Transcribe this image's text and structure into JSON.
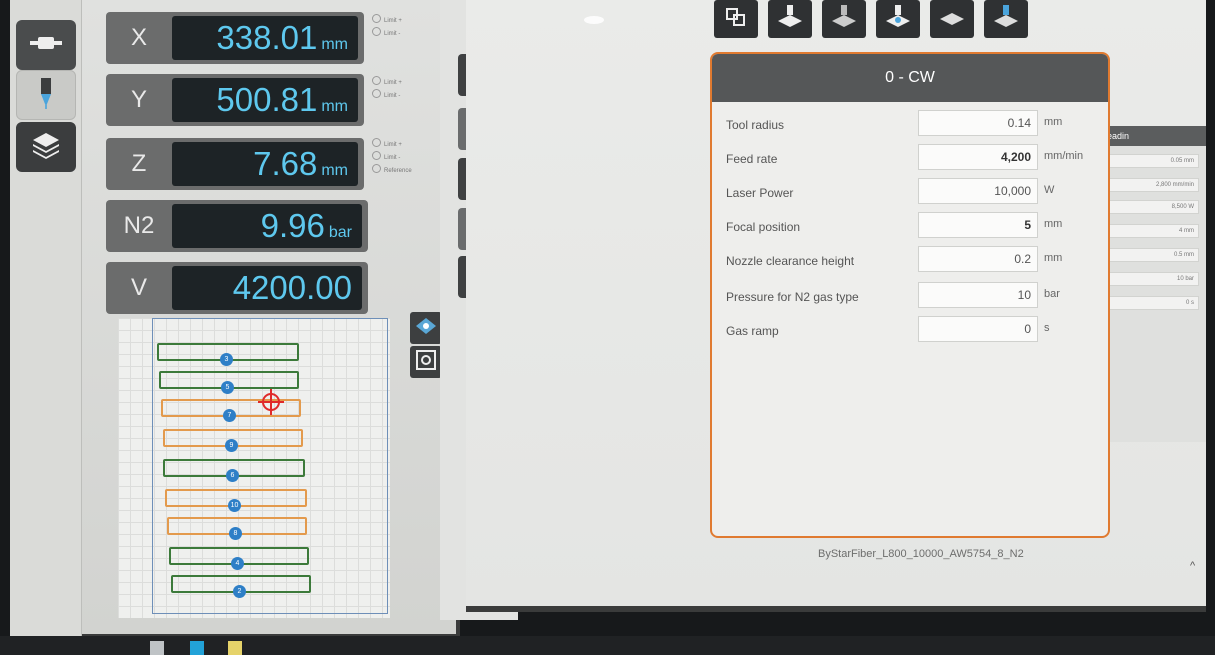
{
  "left_tabs": [
    {
      "name": "machine-tab",
      "icon": "machine-head-icon"
    },
    {
      "name": "laser-tab",
      "icon": "laser-nozzle-icon"
    },
    {
      "name": "layers-tab",
      "icon": "layers-icon"
    }
  ],
  "axes": [
    {
      "id": "x",
      "label": "X",
      "value": "338.01",
      "unit": "mm",
      "limits": [
        "Limit +",
        "Limit -"
      ]
    },
    {
      "id": "y",
      "label": "Y",
      "value": "500.81",
      "unit": "mm",
      "limits": [
        "Limit +",
        "Limit -"
      ]
    },
    {
      "id": "z",
      "label": "Z",
      "value": "7.68",
      "unit": "mm",
      "limits": [
        "Limit +",
        "Limit -",
        "Reference"
      ]
    },
    {
      "id": "n2",
      "label": "N2",
      "value": "9.96",
      "unit": "bar",
      "limits": []
    },
    {
      "id": "v",
      "label": "V",
      "value": "4200.00",
      "unit": "",
      "limits": []
    }
  ],
  "sheet_parts": [
    {
      "num": "3",
      "color": "green"
    },
    {
      "num": "5",
      "color": "green"
    },
    {
      "num": "7",
      "color": "orange"
    },
    {
      "num": "9",
      "color": "orange"
    },
    {
      "num": "6",
      "color": "green"
    },
    {
      "num": "10",
      "color": "orange"
    },
    {
      "num": "8",
      "color": "orange"
    },
    {
      "num": "4",
      "color": "green"
    },
    {
      "num": "2",
      "color": "green"
    }
  ],
  "dialog": {
    "title": "0 - CW",
    "params": [
      {
        "label": "Tool radius",
        "value": "0.14",
        "unit": "mm",
        "bold": false
      },
      {
        "label": "Feed rate",
        "value": "4,200",
        "unit": "mm/min",
        "bold": true
      },
      {
        "label": "Laser Power",
        "value": "10,000",
        "unit": "W",
        "bold": false
      },
      {
        "label": "Focal position",
        "value": "5",
        "unit": "mm",
        "bold": true
      },
      {
        "label": "Nozzle clearance height",
        "value": "0.2",
        "unit": "mm",
        "bold": false
      },
      {
        "label": "Pressure for N2 gas type",
        "value": "10",
        "unit": "bar",
        "bold": false
      },
      {
        "label": "Gas ramp",
        "value": "0",
        "unit": "s",
        "bold": false
      }
    ]
  },
  "background_window": {
    "title_fragment": "eadin",
    "values": [
      "0.05 mm",
      "2,800 mm/min",
      "8,500 W",
      "4 mm",
      "0.5 mm",
      "10 bar",
      "0 s"
    ]
  },
  "file_name": "ByStarFiber_L800_10000_AW5754_8_N2",
  "colors": {
    "display_text": "#5ec8ee",
    "dialog_border": "#e07a30",
    "part_green": "#3c7a3a",
    "part_orange": "#e39a4c",
    "crosshair": "#e02a2a"
  }
}
